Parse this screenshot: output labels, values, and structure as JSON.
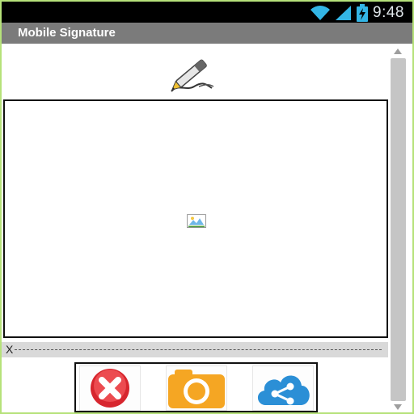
{
  "status_bar": {
    "time": "9:48",
    "icons": [
      "wifi-icon",
      "signal-icon",
      "battery-charging-icon"
    ]
  },
  "title_bar": {
    "title": "Mobile Signature"
  },
  "signature": {
    "header_icon": "pen-signature-icon",
    "placeholder_icon": "broken-image-icon",
    "sign_line_marker": "X"
  },
  "actions": [
    {
      "name": "clear",
      "icon": "red-x-close-icon",
      "color": "#e0343a"
    },
    {
      "name": "camera",
      "icon": "camera-icon",
      "color": "#f5a623"
    },
    {
      "name": "share",
      "icon": "cloud-share-icon",
      "color": "#2b8fd6"
    }
  ],
  "colors": {
    "frame_border": "#b6e27a",
    "title_bar_bg": "#7b7b7b",
    "status_bar_bg": "#000000"
  }
}
